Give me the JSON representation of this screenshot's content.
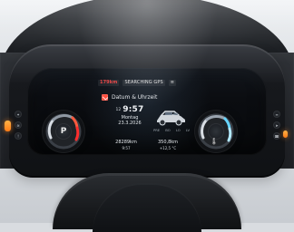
{
  "status_bar": {
    "left_text": "179km",
    "center_text": "SEARCHING GPS",
    "right_text": "≡"
  },
  "screen": {
    "title": "Datum & Uhrzeit",
    "time_prefix": "12",
    "time": "9:57",
    "weekday": "Montag",
    "date": "23.3.2026"
  },
  "left_gauge": {
    "gear": "P"
  },
  "right_gauge": {
    "icon": "temperature-icon"
  },
  "car_indicators": {
    "items": [
      "PRE",
      "BO",
      "LO",
      "LV"
    ]
  },
  "bottom_info": {
    "odometer": "28289km",
    "clock": "9:57",
    "range": "350,8km",
    "outside_temp": "+12,5 °C"
  },
  "colors": {
    "accent_red": "#ff4a4a",
    "accent_orange": "#ff8a1f",
    "screen_blue": "#7e9ab5"
  },
  "icons": {
    "title_icon": "calendar-icon",
    "car_icon": "car-icon",
    "left_control_1": "light-icon",
    "left_control_2": "fog-icon",
    "left_control_3": "warning-icon",
    "right_control_1": "menu-icon",
    "right_control_2": "nav-icon",
    "right_control_3": "phone-icon"
  }
}
